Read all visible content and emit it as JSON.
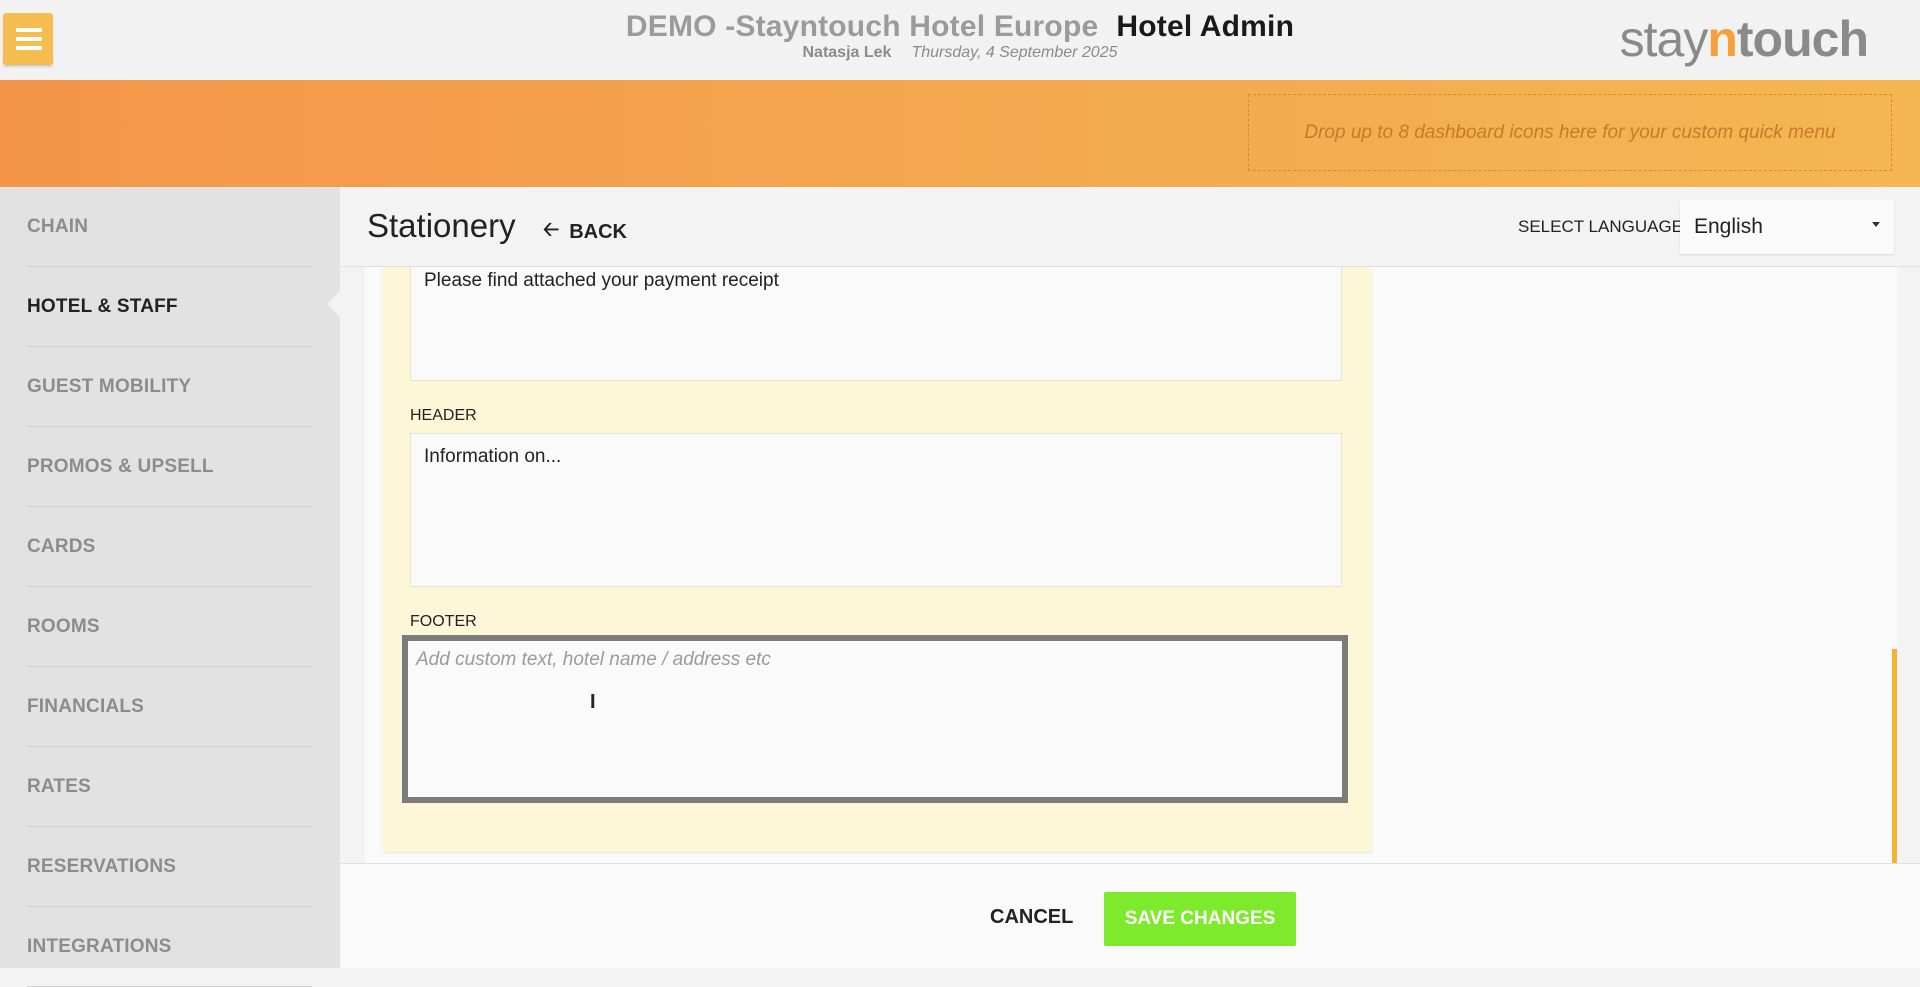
{
  "header": {
    "hotel_name": "DEMO -Stayntouch Hotel Europe",
    "app_name": "Hotel Admin",
    "user_name": "Natasja Lek",
    "date": "Thursday, 4 September 2025",
    "brand": {
      "part1": "stay",
      "part2": "n",
      "part3": "touch"
    }
  },
  "dropzone": {
    "text": "Drop up to 8 dashboard icons here for your custom quick menu"
  },
  "sidebar": {
    "items": [
      {
        "label": "CHAIN"
      },
      {
        "label": "HOTEL & STAFF"
      },
      {
        "label": "GUEST MOBILITY"
      },
      {
        "label": "PROMOS & UPSELL"
      },
      {
        "label": "CARDS"
      },
      {
        "label": "ROOMS"
      },
      {
        "label": "FINANCIALS"
      },
      {
        "label": "RATES"
      },
      {
        "label": "RESERVATIONS"
      },
      {
        "label": "INTEGRATIONS"
      }
    ],
    "active_index": 1
  },
  "page": {
    "title": "Stationery",
    "back_label": "BACK",
    "language_label": "SELECT LANGUAGE",
    "language_value": "English"
  },
  "form": {
    "body_value": "Please find attached your payment receipt",
    "header_label": "HEADER",
    "header_value": "Information on...",
    "footer_label": "FOOTER",
    "footer_placeholder": "Add custom text, hotel name / address etc"
  },
  "actions": {
    "cancel_label": "CANCEL",
    "save_label": "SAVE CHANGES"
  },
  "colors": {
    "accent_orange": "#f5bd4f",
    "save_green": "#7eea2c",
    "panel_yellow": "#fdf6d7"
  }
}
